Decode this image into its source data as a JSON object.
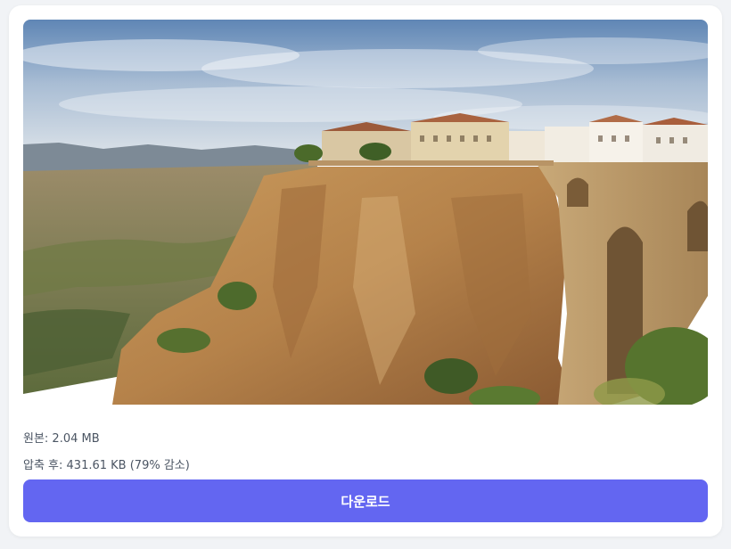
{
  "result": {
    "original_label": "원본: 2.04 MB",
    "compressed_label": "압축 후: 431.61 KB (79% 감소)",
    "download_label": "다운로드"
  },
  "colors": {
    "accent": "#6366f1",
    "card_background": "#ffffff",
    "page_background": "#f1f3f6"
  }
}
